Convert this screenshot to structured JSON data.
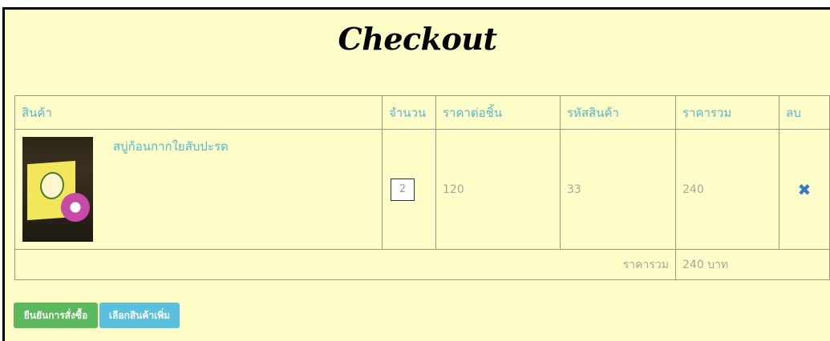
{
  "page": {
    "title": "Checkout"
  },
  "table": {
    "headers": {
      "product": "สินค้า",
      "quantity": "จำนวน",
      "unit_price": "ราคาต่อชิ้น",
      "product_code": "รหัสสินค้า",
      "total": "ราคารวม",
      "delete": "ลบ"
    },
    "rows": [
      {
        "name": "สบู่ก้อนกากใยสับปะรด",
        "quantity": "2",
        "unit_price": "120",
        "product_code": "33",
        "total": "240",
        "delete_icon": "close-icon"
      }
    ],
    "summary": {
      "label": "ราคารวม",
      "value": "240 บาท"
    }
  },
  "actions": {
    "confirm_label": "ยืนยันการสั่งซื้อ",
    "more_label": "เลือกสินค้าเพิ่ม"
  },
  "colors": {
    "background": "#fffec8",
    "header_text": "#54b8c9",
    "cell_text": "#a5a59a",
    "confirm_button": "#5cb85c",
    "more_button": "#5bc0de",
    "delete_icon": "#2f7fc0"
  }
}
